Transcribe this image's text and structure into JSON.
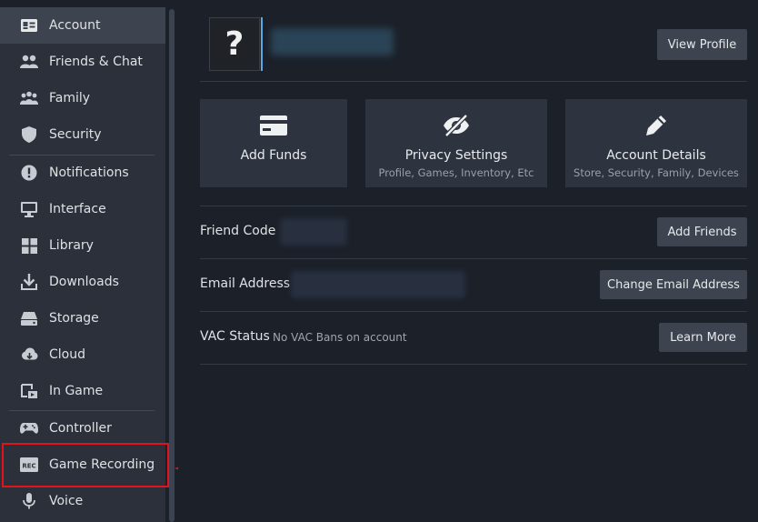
{
  "sidebar": {
    "items": [
      {
        "label": "Account",
        "icon": "account-card-icon",
        "active": true
      },
      {
        "label": "Friends & Chat",
        "icon": "friends-icon"
      },
      {
        "label": "Family",
        "icon": "family-icon"
      },
      {
        "label": "Security",
        "icon": "shield-icon"
      },
      {
        "label": "Notifications",
        "icon": "alert-icon"
      },
      {
        "label": "Interface",
        "icon": "monitor-icon"
      },
      {
        "label": "Library",
        "icon": "library-grid-icon"
      },
      {
        "label": "Downloads",
        "icon": "download-icon"
      },
      {
        "label": "Storage",
        "icon": "storage-drive-icon"
      },
      {
        "label": "Cloud",
        "icon": "cloud-icon"
      },
      {
        "label": "In Game",
        "icon": "in-game-icon"
      },
      {
        "label": "Controller",
        "icon": "gamepad-icon"
      },
      {
        "label": "Game Recording",
        "icon": "rec-icon"
      },
      {
        "label": "Voice",
        "icon": "microphone-icon"
      }
    ]
  },
  "profile": {
    "avatar_glyph": "?",
    "view_profile_label": "View Profile"
  },
  "tiles": [
    {
      "title": "Add Funds",
      "subtitle": "",
      "icon": "credit-card-icon"
    },
    {
      "title": "Privacy Settings",
      "subtitle": "Profile, Games, Inventory, Etc",
      "icon": "eye-slash-icon"
    },
    {
      "title": "Account Details",
      "subtitle": "Store, Security, Family, Devices",
      "icon": "pencil-icon"
    }
  ],
  "rows": {
    "friend_code": {
      "label": "Friend Code",
      "button": "Add Friends"
    },
    "email": {
      "label": "Email Address",
      "button": "Change Email Address"
    },
    "vac": {
      "label": "VAC Status",
      "value": "No VAC Bans on account",
      "button": "Learn More"
    }
  },
  "colors": {
    "background": "#1b2029",
    "sidebar": "#2b303b",
    "active_item": "#3d4450",
    "button": "#3d4450",
    "highlight": "#e0141a",
    "avatar_accent": "#5aa9e6"
  }
}
